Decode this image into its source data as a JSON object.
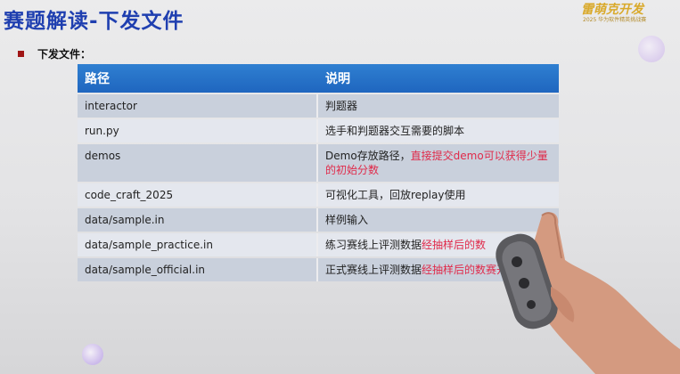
{
  "slide": {
    "title": "赛题解读-下发文件",
    "subtitle": "下发文件：",
    "logo_text": "雷萌克开发",
    "logo_subtext": "2025 华为软件精英挑战赛",
    "colors": {
      "title": "#1f3fb0",
      "header": "#2472c8",
      "highlight": "#e02a4a",
      "bullet": "#a01515"
    }
  },
  "table": {
    "headers": [
      "路径",
      "说明"
    ],
    "rows": [
      {
        "path": "interactor",
        "desc": "判题器",
        "highlight": ""
      },
      {
        "path": "run.py",
        "desc": "选手和判题器交互需要的脚本",
        "highlight": ""
      },
      {
        "path": "demos",
        "desc": "Demo存放路径，",
        "highlight": "直接提交demo可以获得少量的初始分数"
      },
      {
        "path": "code_craft_2025",
        "desc": "可视化工具，回放replay使用",
        "highlight": ""
      },
      {
        "path": "data/sample.in",
        "desc": "样例输入",
        "highlight": ""
      },
      {
        "path": "data/sample_practice.in",
        "desc": "练习赛线上评测数据",
        "highlight": "经抽样后的数"
      },
      {
        "path": "data/sample_official.in",
        "desc": "正式赛线上评测数据",
        "highlight": "经抽样后的数赛开始后提供"
      }
    ]
  }
}
